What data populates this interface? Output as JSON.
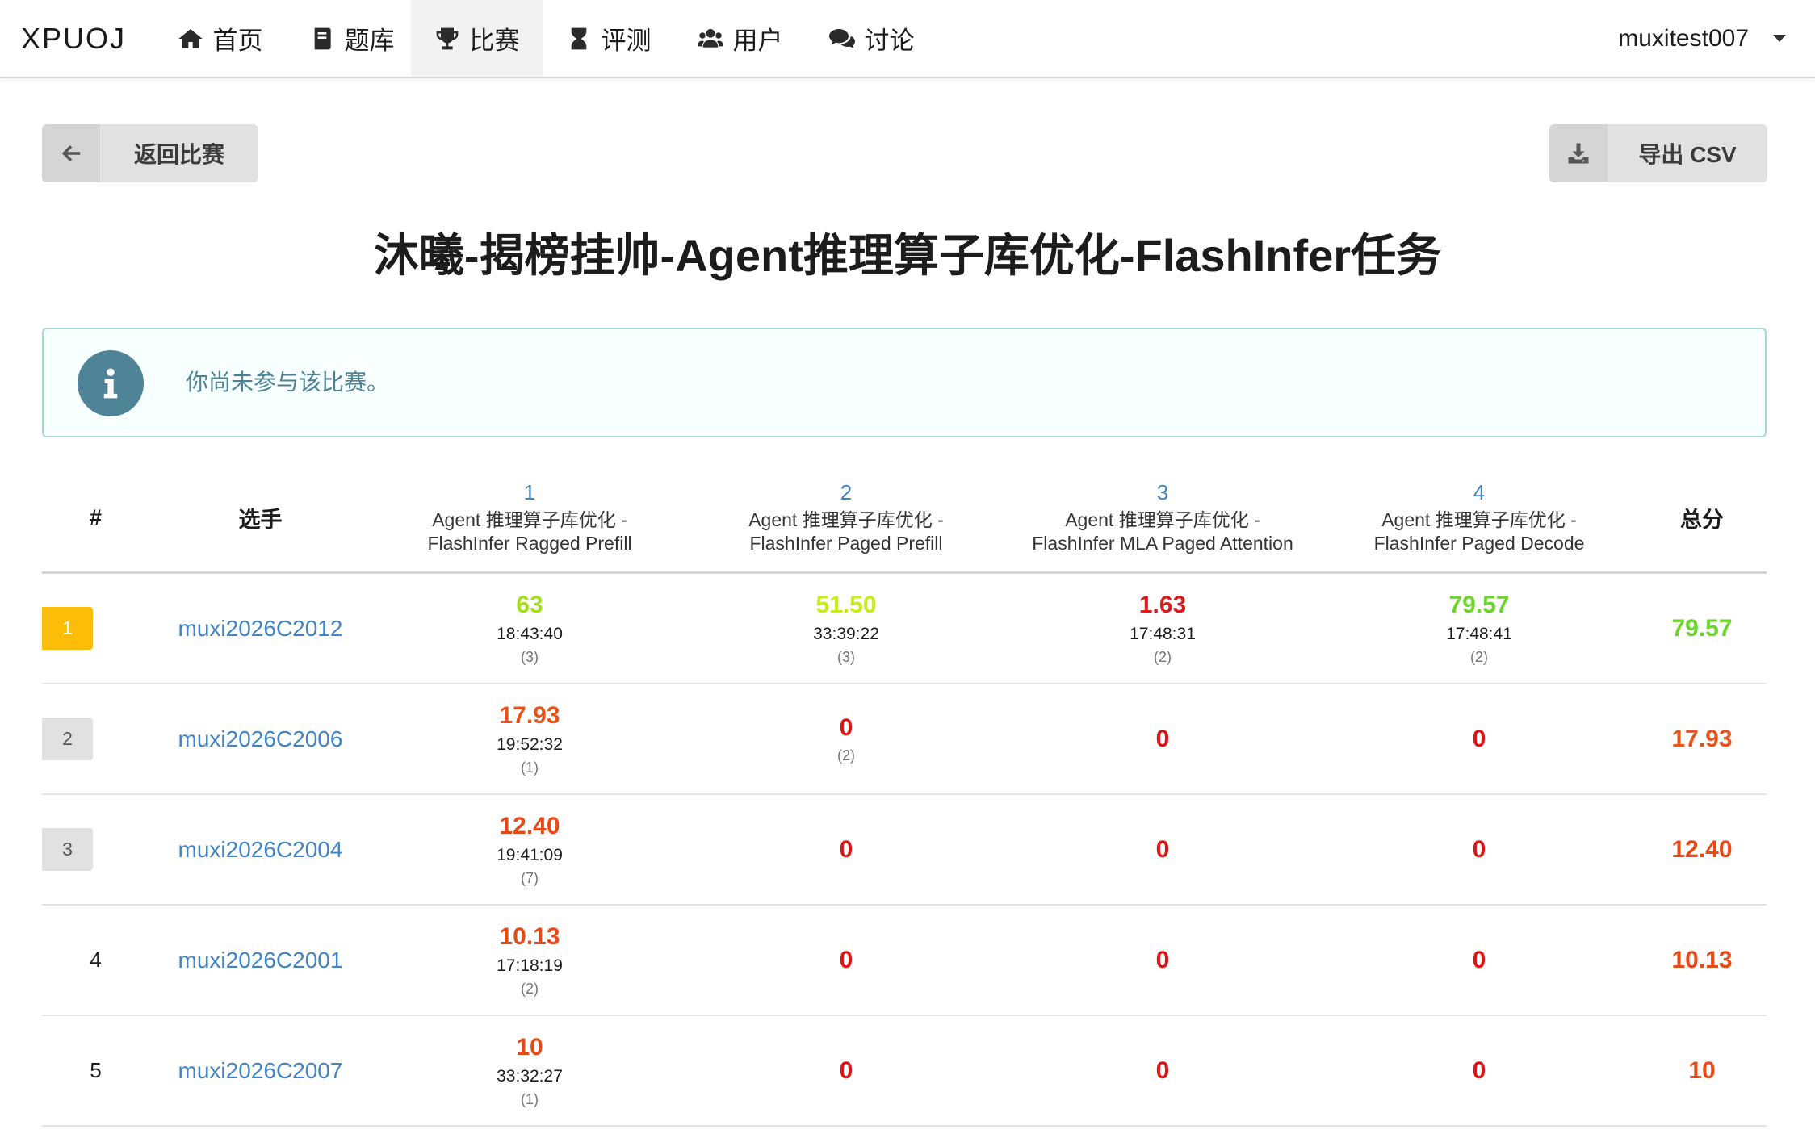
{
  "nav": {
    "brand": "XPUOJ",
    "items": [
      {
        "label": "首页",
        "icon": "home-icon"
      },
      {
        "label": "题库",
        "icon": "book-icon"
      },
      {
        "label": "比赛",
        "icon": "trophy-icon"
      },
      {
        "label": "评测",
        "icon": "hourglass-icon"
      },
      {
        "label": "用户",
        "icon": "users-icon"
      },
      {
        "label": "讨论",
        "icon": "comments-icon"
      }
    ],
    "active_index": 2,
    "username": "muxitest007"
  },
  "actions": {
    "back_label": "返回比赛",
    "export_label": "导出 CSV"
  },
  "contest_title": "沐曦-揭榜挂帅-Agent推理算子库优化-FlashInfer任务",
  "info_message": "你尚未参与该比赛。",
  "colors": {
    "link": "#4183c4",
    "rank1_badge": "#fbbd08",
    "rank_badge": "#e0e1e2",
    "info_icon": "#4f8397"
  },
  "table": {
    "headers": {
      "rank": "#",
      "player": "选手",
      "total": "总分"
    },
    "problems": [
      {
        "num": "1",
        "name_line1": "Agent 推理算子库优化 -",
        "name_line2": "FlashInfer Ragged Prefill"
      },
      {
        "num": "2",
        "name_line1": "Agent 推理算子库优化 -",
        "name_line2": "FlashInfer Paged Prefill"
      },
      {
        "num": "3",
        "name_line1": "Agent 推理算子库优化 -",
        "name_line2": "FlashInfer MLA Paged Attention"
      },
      {
        "num": "4",
        "name_line1": "Agent 推理算子库优化 -",
        "name_line2": "FlashInfer Paged Decode"
      }
    ],
    "rows": [
      {
        "rank": "1",
        "badge": "gold",
        "player": "muxi2026C2012",
        "cells": [
          {
            "score": "63",
            "time": "18:43:40",
            "tries": "(3)",
            "color": "#a3e01b"
          },
          {
            "score": "51.50",
            "time": "33:39:22",
            "tries": "(3)",
            "color": "#c6ec1c"
          },
          {
            "score": "1.63",
            "time": "17:48:31",
            "tries": "(2)",
            "color": "#d81c1c"
          },
          {
            "score": "79.57",
            "time": "17:48:41",
            "tries": "(2)",
            "color": "#6bd62a"
          }
        ],
        "total": "79.57",
        "total_color": "#6bd62a"
      },
      {
        "rank": "2",
        "badge": "grey",
        "player": "muxi2026C2006",
        "cells": [
          {
            "score": "17.93",
            "time": "19:52:32",
            "tries": "(1)",
            "color": "#e8531a"
          },
          {
            "score": "0",
            "time": "",
            "tries": "(2)",
            "color": "#db1515"
          },
          {
            "score": "0",
            "time": "",
            "tries": "",
            "color": "#db1515"
          },
          {
            "score": "0",
            "time": "",
            "tries": "",
            "color": "#db1515"
          }
        ],
        "total": "17.93",
        "total_color": "#e8531a"
      },
      {
        "rank": "3",
        "badge": "grey",
        "player": "muxi2026C2004",
        "cells": [
          {
            "score": "12.40",
            "time": "19:41:09",
            "tries": "(7)",
            "color": "#e84a17"
          },
          {
            "score": "0",
            "time": "",
            "tries": "",
            "color": "#db1515"
          },
          {
            "score": "0",
            "time": "",
            "tries": "",
            "color": "#db1515"
          },
          {
            "score": "0",
            "time": "",
            "tries": "",
            "color": "#db1515"
          }
        ],
        "total": "12.40",
        "total_color": "#e84a17"
      },
      {
        "rank": "4",
        "badge": "none",
        "player": "muxi2026C2001",
        "cells": [
          {
            "score": "10.13",
            "time": "17:18:19",
            "tries": "(2)",
            "color": "#e84a17"
          },
          {
            "score": "0",
            "time": "",
            "tries": "",
            "color": "#db1515"
          },
          {
            "score": "0",
            "time": "",
            "tries": "",
            "color": "#db1515"
          },
          {
            "score": "0",
            "time": "",
            "tries": "",
            "color": "#db1515"
          }
        ],
        "total": "10.13",
        "total_color": "#e84a17"
      },
      {
        "rank": "5",
        "badge": "none",
        "player": "muxi2026C2007",
        "cells": [
          {
            "score": "10",
            "time": "33:32:27",
            "tries": "(1)",
            "color": "#e84a17"
          },
          {
            "score": "0",
            "time": "",
            "tries": "",
            "color": "#db1515"
          },
          {
            "score": "0",
            "time": "",
            "tries": "",
            "color": "#db1515"
          },
          {
            "score": "0",
            "time": "",
            "tries": "",
            "color": "#db1515"
          }
        ],
        "total": "10",
        "total_color": "#e84a17"
      }
    ]
  }
}
